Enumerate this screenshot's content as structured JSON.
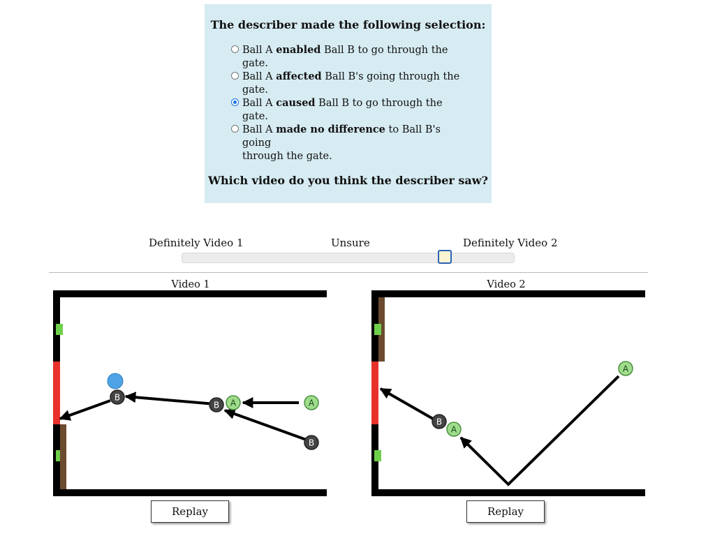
{
  "panel": {
    "heading": "The describer made the following selection:",
    "options": [
      {
        "pre": "Ball A ",
        "bold": "enabled",
        "post": " Ball B to go through the gate.",
        "cont": "",
        "selected": false
      },
      {
        "pre": "Ball A ",
        "bold": "affected",
        "post": " Ball B's going through the gate.",
        "cont": "",
        "selected": false
      },
      {
        "pre": "Ball A ",
        "bold": "caused",
        "post": " Ball B to go through the gate.",
        "cont": "",
        "selected": true
      },
      {
        "pre": "Ball A ",
        "bold": "made no difference",
        "post": " to Ball B's going",
        "cont": "through the gate.",
        "selected": false
      }
    ],
    "question": "Which video do you think the describer saw?"
  },
  "slider": {
    "left_label": "Definitely Video 1",
    "center_label": "Unsure",
    "right_label": "Definitely Video 2",
    "value": 0.79
  },
  "videos": [
    {
      "title": "Video 1",
      "replay_label": "Replay"
    },
    {
      "title": "Video 2",
      "replay_label": "Replay"
    }
  ],
  "ball_labels": {
    "a": "A",
    "b": "B"
  },
  "colors": {
    "panel_bg": "#d6ebf2",
    "wall": "#000000",
    "gate": "#e8312a",
    "marker": "#6ed04a",
    "block": "#6b4a2e",
    "ball_a": "#9fdc8c",
    "ball_b": "#444444",
    "ball_blue": "#4ea3e4"
  }
}
